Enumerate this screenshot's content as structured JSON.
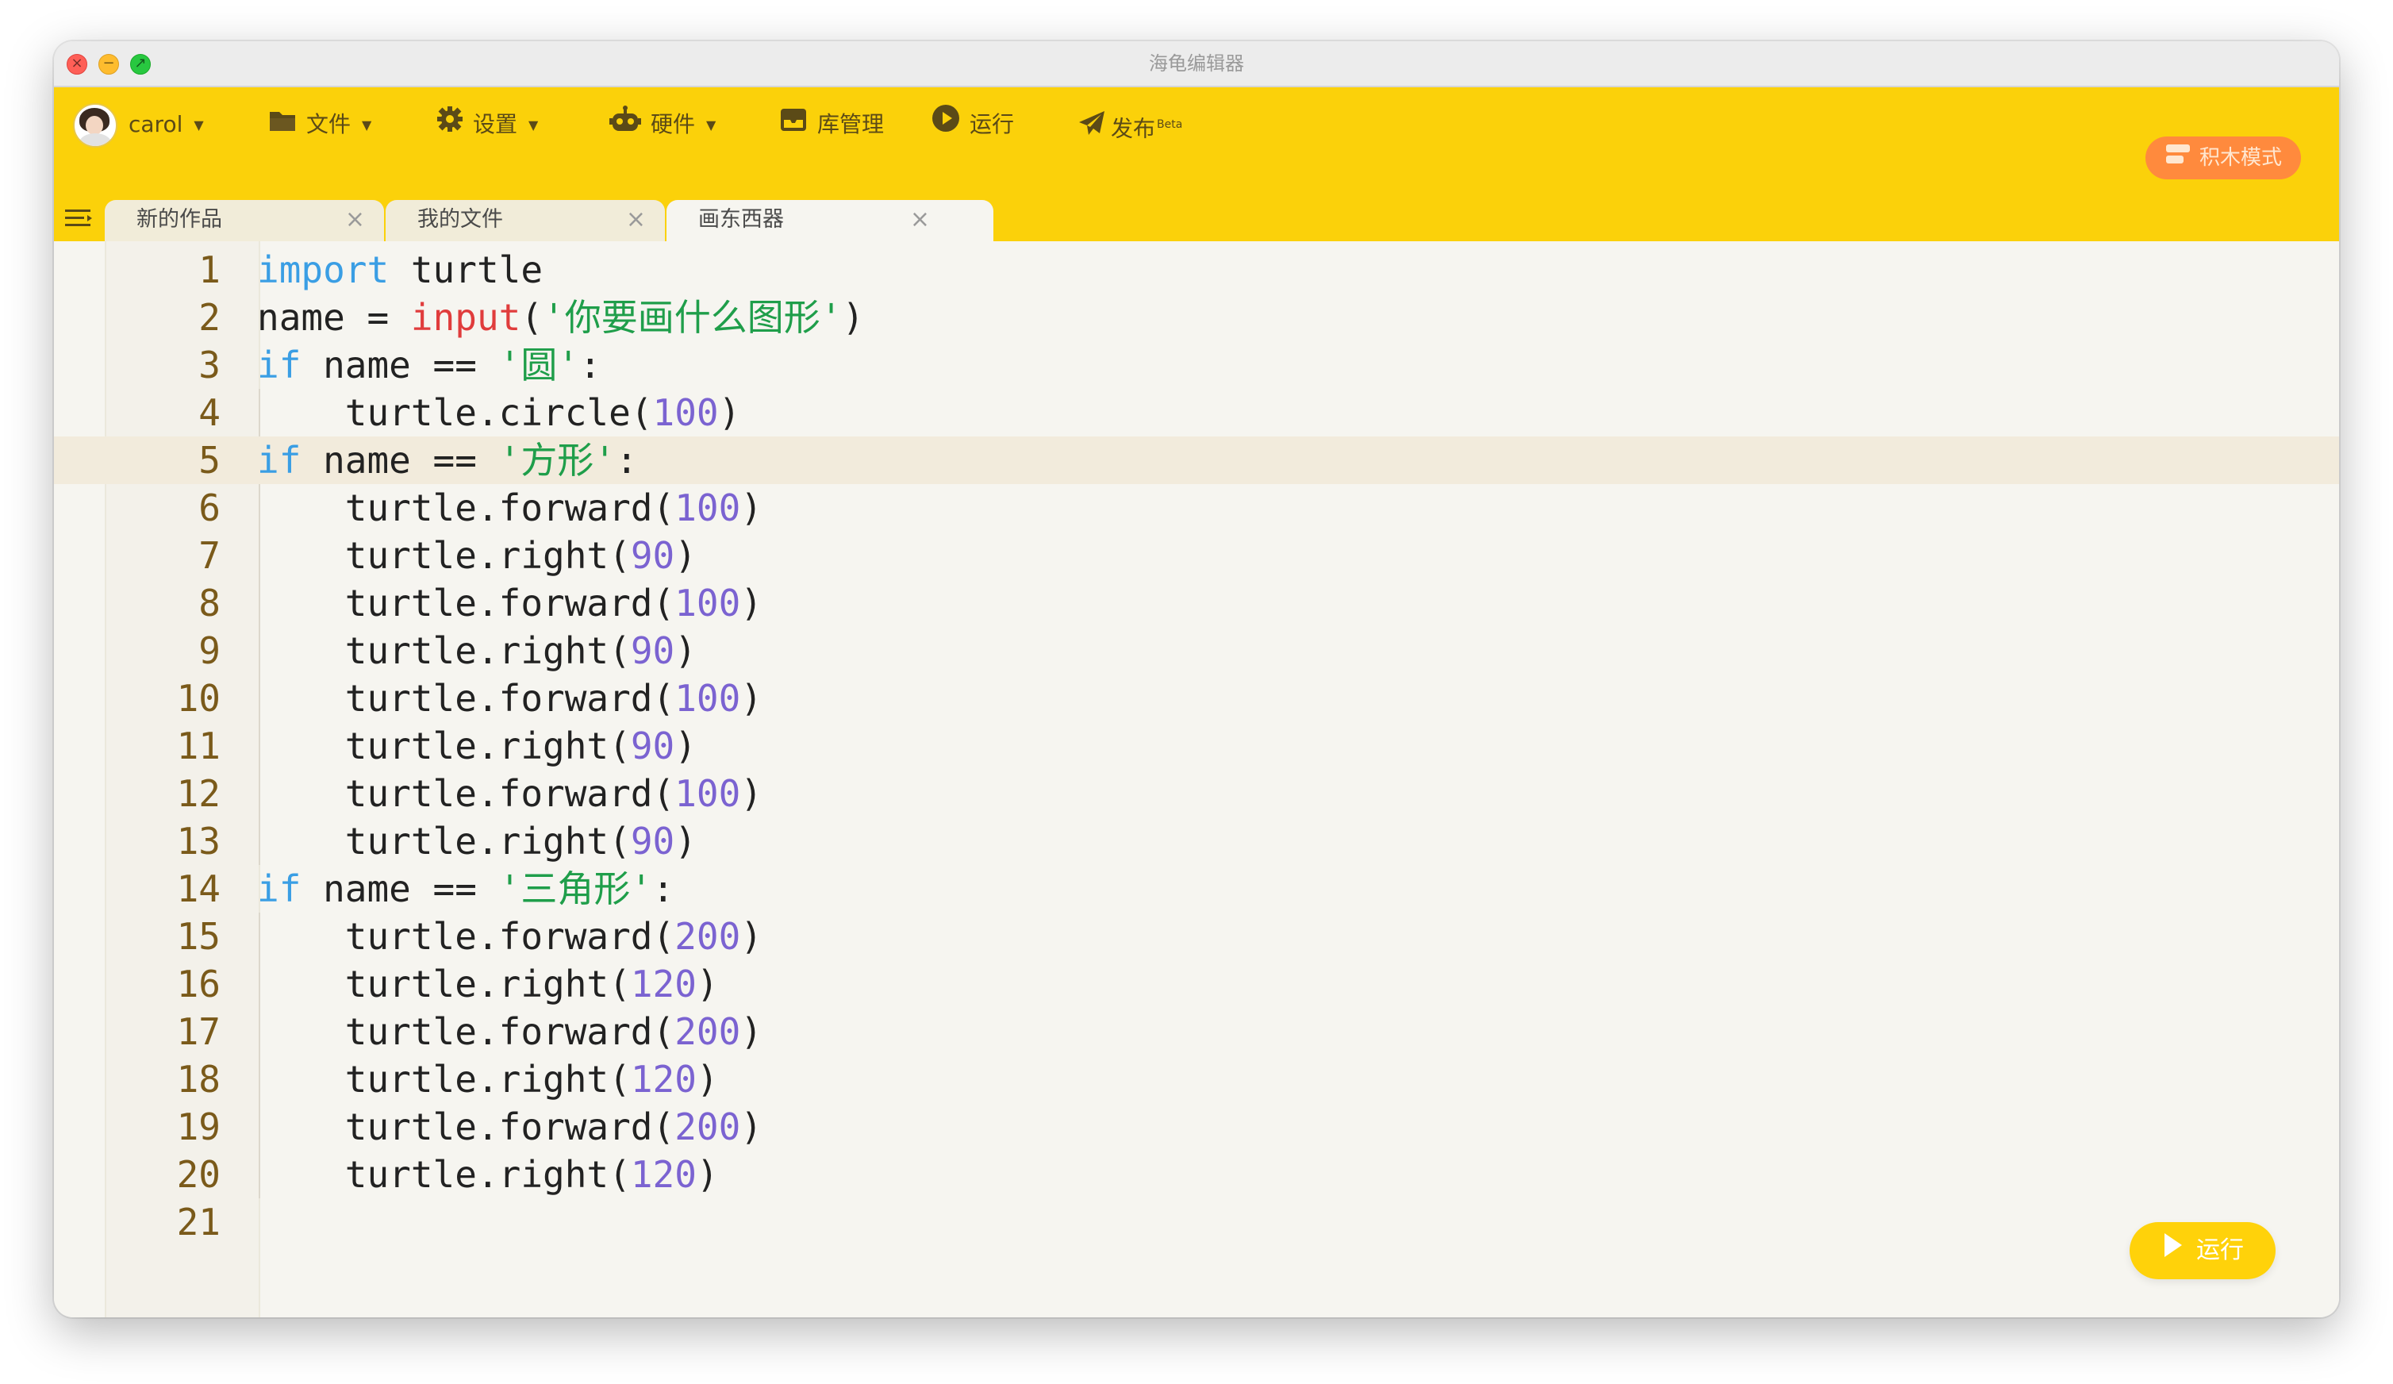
{
  "window": {
    "title": "海龟编辑器"
  },
  "toolbar": {
    "user": "carol",
    "file": "文件",
    "settings": "设置",
    "hardware": "硬件",
    "library": "库管理",
    "run": "运行",
    "publish": "发布",
    "publish_badge": "Beta",
    "mode_button": "积木模式"
  },
  "tabs": [
    {
      "label": "新的作品",
      "close": "×"
    },
    {
      "label": "我的文件",
      "close": "×"
    },
    {
      "label": "画东西器",
      "close": "×"
    }
  ],
  "editor": {
    "current_line": 5,
    "lines": [
      {
        "n": "1",
        "parts": [
          {
            "t": "import",
            "c": "kw"
          },
          {
            "t": " turtle",
            "c": ""
          }
        ]
      },
      {
        "n": "2",
        "parts": [
          {
            "t": "name = ",
            "c": ""
          },
          {
            "t": "input",
            "c": "bi"
          },
          {
            "t": "(",
            "c": ""
          },
          {
            "t": "'你要画什么图形'",
            "c": "str"
          },
          {
            "t": ")",
            "c": ""
          }
        ]
      },
      {
        "n": "3",
        "parts": [
          {
            "t": "if",
            "c": "kw"
          },
          {
            "t": " name == ",
            "c": ""
          },
          {
            "t": "'圆'",
            "c": "str"
          },
          {
            "t": ":",
            "c": ""
          }
        ]
      },
      {
        "n": "4",
        "parts": [
          {
            "t": "    turtle.circle(",
            "c": ""
          },
          {
            "t": "100",
            "c": "num"
          },
          {
            "t": ")",
            "c": ""
          }
        ]
      },
      {
        "n": "5",
        "parts": [
          {
            "t": "if",
            "c": "kw"
          },
          {
            "t": " name == ",
            "c": ""
          },
          {
            "t": "'方形'",
            "c": "str"
          },
          {
            "t": ":",
            "c": ""
          }
        ]
      },
      {
        "n": "6",
        "parts": [
          {
            "t": "    turtle.forward(",
            "c": ""
          },
          {
            "t": "100",
            "c": "num"
          },
          {
            "t": ")",
            "c": ""
          }
        ]
      },
      {
        "n": "7",
        "parts": [
          {
            "t": "    turtle.right(",
            "c": ""
          },
          {
            "t": "90",
            "c": "num"
          },
          {
            "t": ")",
            "c": ""
          }
        ]
      },
      {
        "n": "8",
        "parts": [
          {
            "t": "    turtle.forward(",
            "c": ""
          },
          {
            "t": "100",
            "c": "num"
          },
          {
            "t": ")",
            "c": ""
          }
        ]
      },
      {
        "n": "9",
        "parts": [
          {
            "t": "    turtle.right(",
            "c": ""
          },
          {
            "t": "90",
            "c": "num"
          },
          {
            "t": ")",
            "c": ""
          }
        ]
      },
      {
        "n": "10",
        "parts": [
          {
            "t": "    turtle.forward(",
            "c": ""
          },
          {
            "t": "100",
            "c": "num"
          },
          {
            "t": ")",
            "c": ""
          }
        ]
      },
      {
        "n": "11",
        "parts": [
          {
            "t": "    turtle.right(",
            "c": ""
          },
          {
            "t": "90",
            "c": "num"
          },
          {
            "t": ")",
            "c": ""
          }
        ]
      },
      {
        "n": "12",
        "parts": [
          {
            "t": "    turtle.forward(",
            "c": ""
          },
          {
            "t": "100",
            "c": "num"
          },
          {
            "t": ")",
            "c": ""
          }
        ]
      },
      {
        "n": "13",
        "parts": [
          {
            "t": "    turtle.right(",
            "c": ""
          },
          {
            "t": "90",
            "c": "num"
          },
          {
            "t": ")",
            "c": ""
          }
        ]
      },
      {
        "n": "14",
        "parts": [
          {
            "t": "if",
            "c": "kw"
          },
          {
            "t": " name == ",
            "c": ""
          },
          {
            "t": "'三角形'",
            "c": "str"
          },
          {
            "t": ":",
            "c": ""
          }
        ]
      },
      {
        "n": "15",
        "parts": [
          {
            "t": "    turtle.forward(",
            "c": ""
          },
          {
            "t": "200",
            "c": "num"
          },
          {
            "t": ")",
            "c": ""
          }
        ]
      },
      {
        "n": "16",
        "parts": [
          {
            "t": "    turtle.right(",
            "c": ""
          },
          {
            "t": "120",
            "c": "num"
          },
          {
            "t": ")",
            "c": ""
          }
        ]
      },
      {
        "n": "17",
        "parts": [
          {
            "t": "    turtle.forward(",
            "c": ""
          },
          {
            "t": "200",
            "c": "num"
          },
          {
            "t": ")",
            "c": ""
          }
        ]
      },
      {
        "n": "18",
        "parts": [
          {
            "t": "    turtle.right(",
            "c": ""
          },
          {
            "t": "120",
            "c": "num"
          },
          {
            "t": ")",
            "c": ""
          }
        ]
      },
      {
        "n": "19",
        "parts": [
          {
            "t": "    turtle.forward(",
            "c": ""
          },
          {
            "t": "200",
            "c": "num"
          },
          {
            "t": ")",
            "c": ""
          }
        ]
      },
      {
        "n": "20",
        "parts": [
          {
            "t": "    turtle.right(",
            "c": ""
          },
          {
            "t": "120",
            "c": "num"
          },
          {
            "t": ")",
            "c": ""
          }
        ]
      },
      {
        "n": "21",
        "parts": []
      }
    ]
  },
  "run_button": {
    "label": "运行"
  },
  "colors": {
    "toolbar": "#fbd10a",
    "keyword": "#3a9ee4",
    "builtin": "#e03c3c",
    "string": "#1f9e4a",
    "number": "#7b63d1",
    "line_number": "#7a5a1a",
    "mode_button": "#ff8a3d",
    "run_button": "#ffd20a"
  }
}
